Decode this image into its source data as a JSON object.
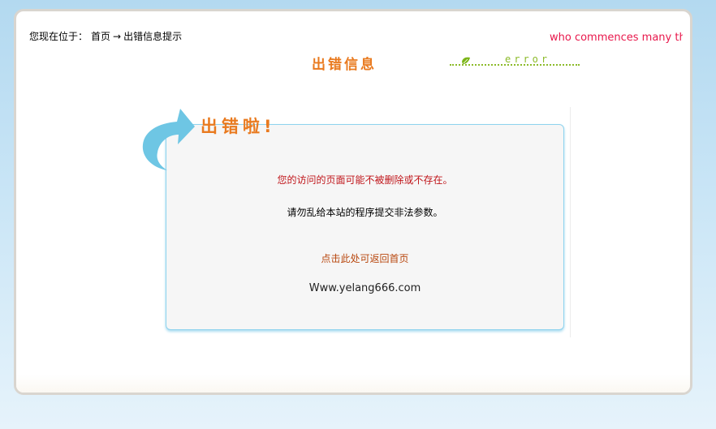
{
  "breadcrumb": {
    "prefix": "您现在位于：",
    "home": "首页",
    "arrow": "→",
    "current": "出错信息提示"
  },
  "marquee": {
    "text": "who commences many things finishes but few",
    "color": "#e8174b"
  },
  "header": {
    "title": "出错信息",
    "error_word": "error",
    "accent_color": "#e97a1f",
    "error_color": "#8cbb2a"
  },
  "error_box": {
    "heading": "出错啦!",
    "message_primary": "您的访问的页面可能不被删除或不存在。",
    "message_secondary": "请勿乱给本站的程序提交非法参数。",
    "back_link": "点击此处可返回首页",
    "site_url": "Www.yelang666.com",
    "border_color": "#8fd3ee",
    "arrow_color": "#6ec6e4"
  },
  "icons": {
    "arrow": "curved-arrow-icon",
    "leaf": "leaf-icon"
  }
}
